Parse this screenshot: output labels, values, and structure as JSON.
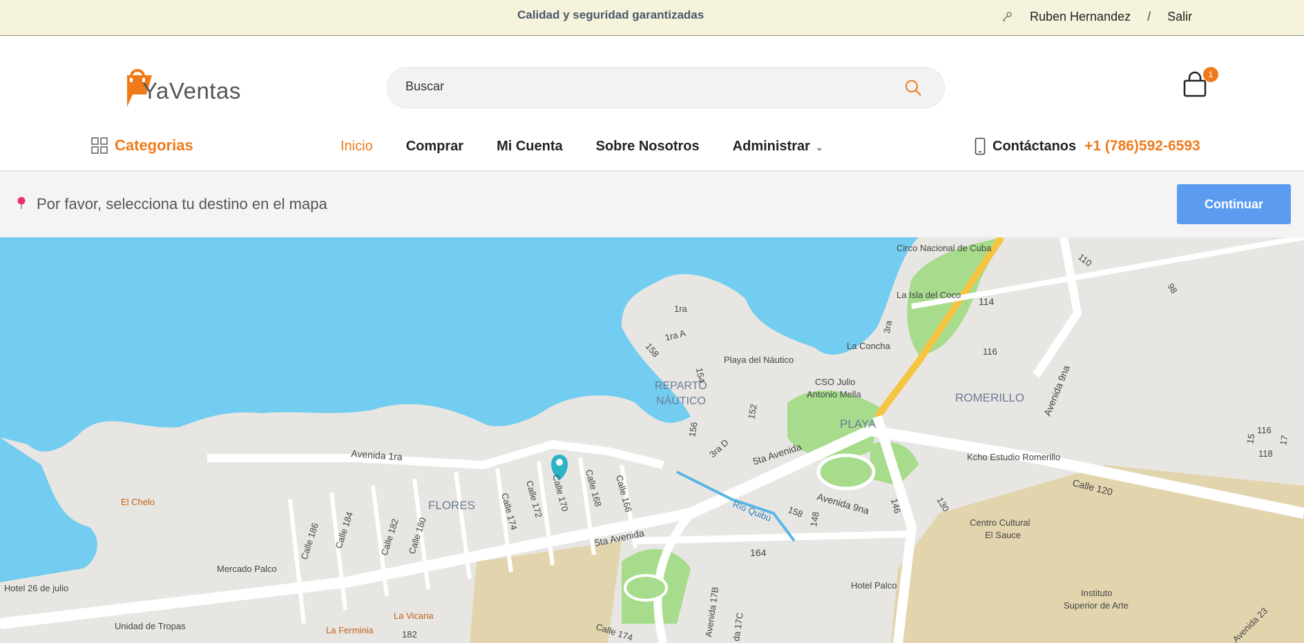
{
  "topbar": {
    "tagline": "Calidad y seguridad garantizadas",
    "user_name": "Ruben Hernandez",
    "separator": "/",
    "logout": "Salir"
  },
  "brand": {
    "name": "YaVentas",
    "accent": "#f07a1a"
  },
  "search": {
    "placeholder": "Buscar"
  },
  "cart": {
    "count": "1"
  },
  "nav": {
    "categories": "Categorias",
    "items": [
      {
        "label": "Inicio",
        "active": true
      },
      {
        "label": "Comprar"
      },
      {
        "label": "Mi Cuenta"
      },
      {
        "label": "Sobre Nosotros"
      },
      {
        "label": "Administrar"
      }
    ],
    "contact_label": "Contáctanos",
    "contact_phone": "+1 (786)592-6593"
  },
  "destination": {
    "message": "Por favor, selecciona tu destino en el mapa",
    "button": "Continuar",
    "button_color": "#5b9bf0"
  },
  "map": {
    "labels": {
      "circo": "Circo Nacional de Cuba",
      "isla": "La Isla del Coco",
      "concha": "La Concha",
      "playa_nautico": "Playa del Náutico",
      "reparto1": "REPARTO",
      "reparto2": "NÁUTICO",
      "cso1": "CSO Julio",
      "cso2": "Antonio Mella",
      "playa": "PLAYA",
      "romerillo": "ROMERILLO",
      "kcho": "Kcho Estudio Romerillo",
      "flores": "FLORES",
      "chelo": "El Chelo",
      "mercado": "Mercado Palco",
      "hotel26": "Hotel 26 de julio",
      "unidad": "Unidad de Tropas",
      "fermina": "La Ferminia",
      "vicaria": "La Vicaria",
      "hotel_palco": "Hotel Palco",
      "centro1": "Centro Cultural",
      "centro2": "El Sauce",
      "instituto1": "Instituto",
      "instituto2": "Superior de Arte",
      "rio": "Río Quibú",
      "av1ra": "Avenida 1ra",
      "av5ta_a": "5ta Avenida",
      "av5ta_b": "5ta Avenida",
      "av9na": "Avenida 9na",
      "av9na_b": "Avenida 9na",
      "calle120": "Calle 120",
      "c170": "Calle 170",
      "c168": "Calle 168",
      "c166": "Calle 166",
      "c172": "Calle 172",
      "c174": "Calle 174",
      "c180": "Calle 180",
      "c182": "Calle 182",
      "c184": "Calle 184",
      "c186": "Calle 186",
      "n164": "164",
      "n146": "146",
      "n148": "148",
      "n158": "158",
      "n130": "130",
      "n152": "152",
      "n154": "154",
      "n156": "156",
      "n158b": "158",
      "n1ra": "1ra",
      "n1raA": "1ra A",
      "n3raD": "3ra D",
      "n114": "114",
      "n116": "116",
      "n110": "110",
      "n98": "98",
      "n3ra": "3ra",
      "n116b": "116",
      "n118": "118",
      "n15": "15",
      "n17": "17",
      "n182": "182",
      "av17b": "Avenida 17B",
      "n17c": "da 17C",
      "calle174": "Calle 174",
      "av23": "Avenida 23"
    }
  }
}
